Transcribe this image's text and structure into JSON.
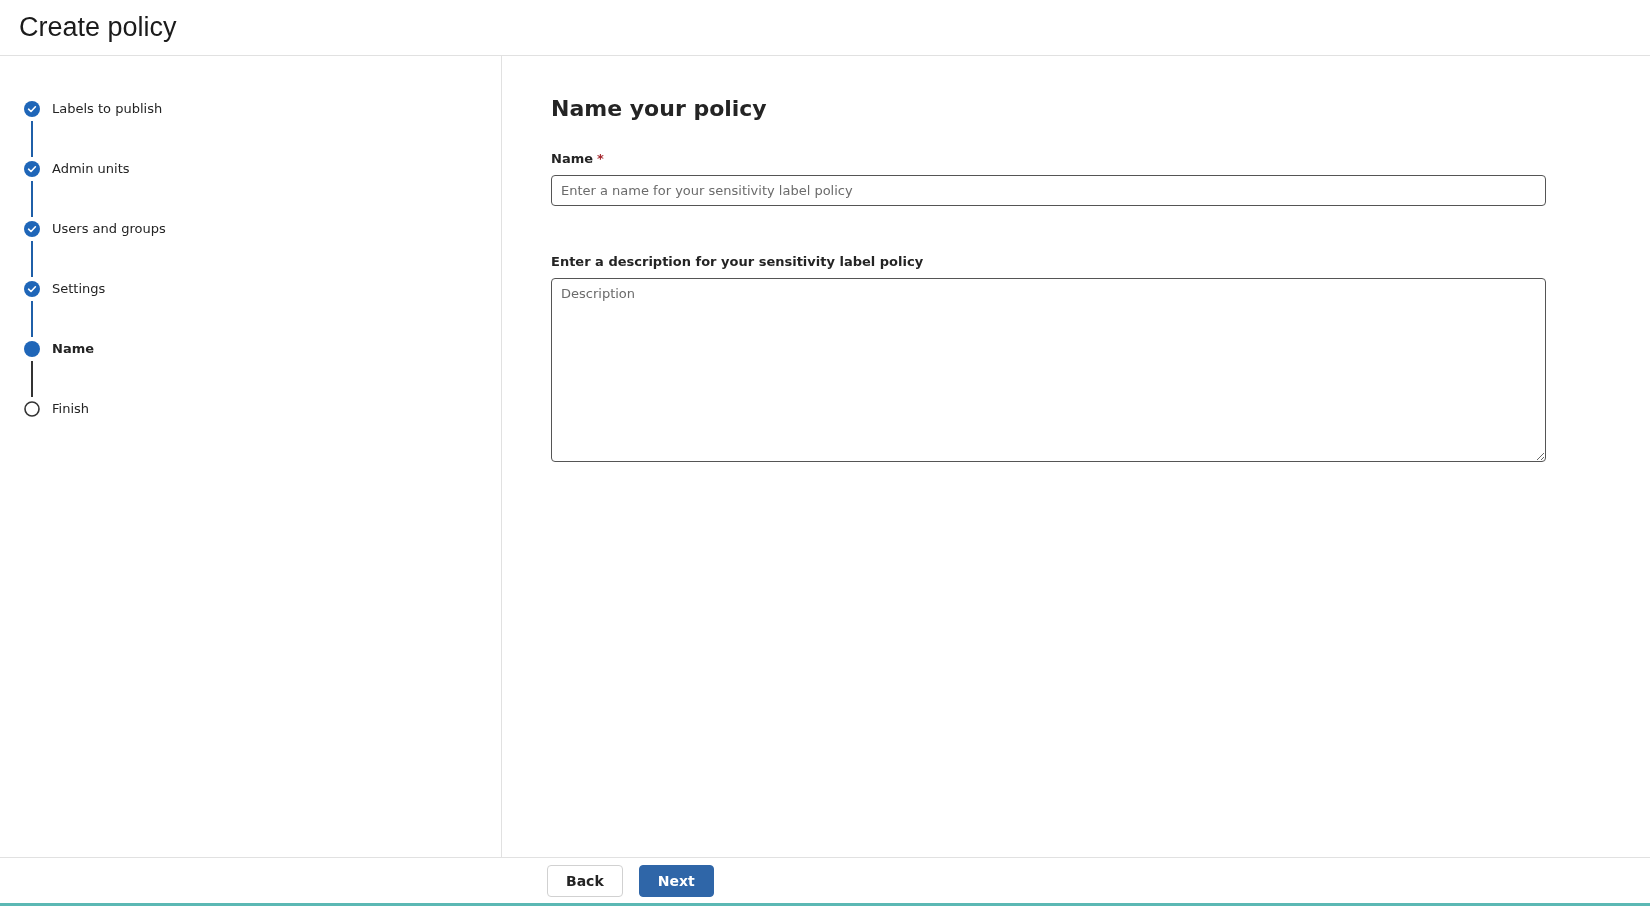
{
  "header": {
    "title": "Create policy"
  },
  "steps": [
    {
      "label": "Labels to publish",
      "kind": "done"
    },
    {
      "label": "Admin units",
      "kind": "done"
    },
    {
      "label": "Users and groups",
      "kind": "done"
    },
    {
      "label": "Settings",
      "kind": "done"
    },
    {
      "label": "Name",
      "kind": "current"
    },
    {
      "label": "Finish",
      "kind": "pending"
    }
  ],
  "form": {
    "heading": "Name your policy",
    "name_field": {
      "label": "Name",
      "required_mark": "*",
      "placeholder": "Enter a name for your sensitivity label policy"
    },
    "description_field": {
      "label": "Enter a description for your sensitivity label policy",
      "placeholder": "Description"
    }
  },
  "footer": {
    "buttons": [
      {
        "label": "Back",
        "kind": "secondary"
      },
      {
        "label": "Next",
        "kind": "primary"
      }
    ]
  }
}
